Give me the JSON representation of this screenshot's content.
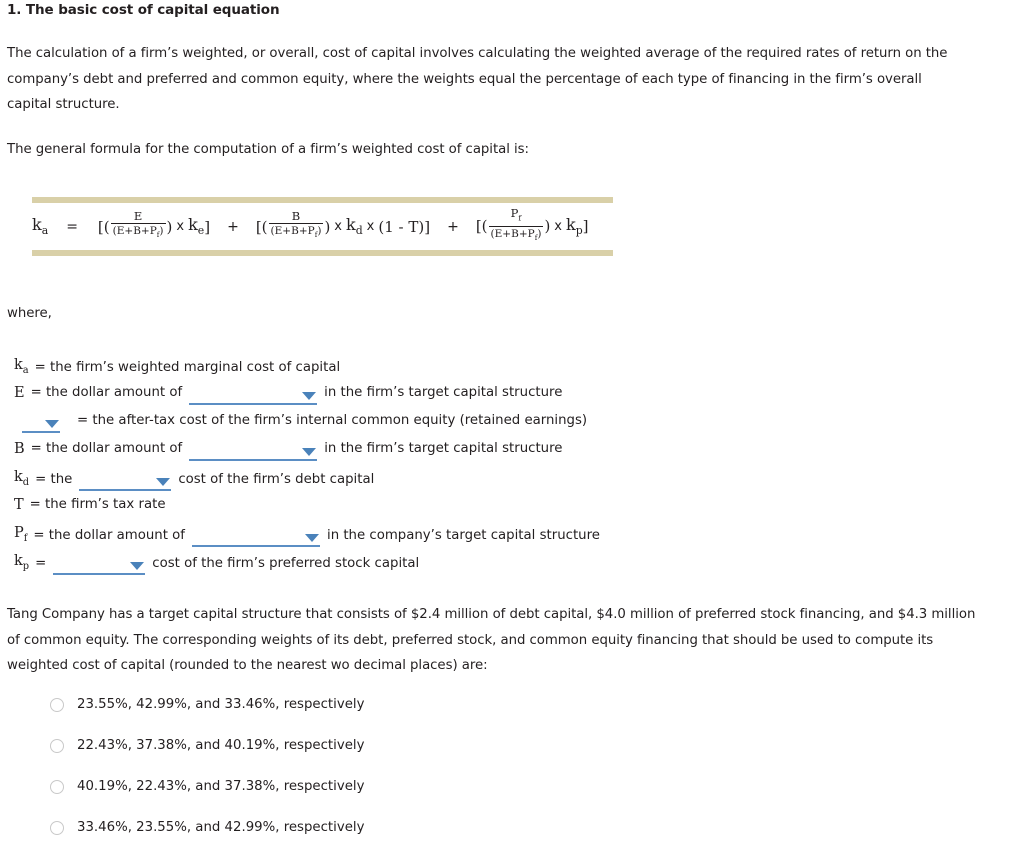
{
  "question": {
    "number_title": "1. The basic cost of capital equation",
    "intro_paragraph": "The calculation of a firm’s weighted, or overall, cost of capital involves calculating the weighted average of the required rates of return on the company’s debt and preferred and common equity, where the weights equal the percentage of each type of financing in the firm’s overall capital structure.",
    "formula_lead": "The general formula for the computation of a firm’s weighted cost of capital is:",
    "where_label": "where,",
    "problem_paragraph": "Tang Company has a target capital structure that consists of $2.4 million of debt capital, $4.0 million of preferred stock financing, and $4.3 million of common equity. The corresponding weights of its debt, preferred stock, and common equity financing that should be used to compute its weighted cost of capital (rounded to the nearest wo decimal places) are:"
  },
  "formula": {
    "band_color": "#d9d0a8",
    "lhs": "k",
    "lhs_sub": "a",
    "equals": "=",
    "plus": "+",
    "terms": [
      {
        "open": "[(",
        "numerator": "E",
        "denominator": "(E+B+P",
        "denominator_sub": "f",
        "denominator_close": ")",
        "close_paren": ")",
        "times": "x",
        "factor": "k",
        "factor_sub": "e",
        "close": "]"
      },
      {
        "open": "[(",
        "numerator": "B",
        "denominator": "(E+B+P",
        "denominator_sub": "f",
        "denominator_close": ")",
        "close_paren": ")",
        "times": "x",
        "factor": "k",
        "factor_sub": "d",
        "times2": "x",
        "tax_factor": "(1 - T)",
        "close": "]"
      },
      {
        "open": "[(",
        "numerator": "P",
        "numerator_sub": "f",
        "denominator": "(E+B+P",
        "denominator_sub": "f",
        "denominator_close": ")",
        "close_paren": ")",
        "times": "x",
        "factor": "k",
        "factor_sub": "p",
        "close": "]"
      }
    ]
  },
  "definitions": [
    {
      "symbol": "k",
      "symbol_sub": "a",
      "pre_text": "= the firm’s weighted marginal cost of capital",
      "has_dropdown": false,
      "post_text": ""
    },
    {
      "symbol": "E",
      "symbol_sub": "",
      "pre_text": "= the dollar amount of",
      "has_dropdown": true,
      "dropdown_value": "",
      "dropdown_width": "wide",
      "post_text": "in the firm’s target capital structure"
    },
    {
      "symbol": "",
      "symbol_sub": "",
      "pre_text": "",
      "has_dropdown": true,
      "dropdown_value": "",
      "dropdown_width": "short",
      "post_text": "= the after-tax cost of the firm’s internal common equity (retained earnings)"
    },
    {
      "symbol": "B",
      "symbol_sub": "",
      "pre_text": "= the dollar amount of",
      "has_dropdown": true,
      "dropdown_value": "",
      "dropdown_width": "wide",
      "post_text": "in the firm’s target capital structure"
    },
    {
      "symbol": "k",
      "symbol_sub": "d",
      "pre_text": "= the",
      "has_dropdown": true,
      "dropdown_value": "",
      "dropdown_width": "med",
      "post_text": "cost of the firm’s debt capital"
    },
    {
      "symbol": "T",
      "symbol_sub": "",
      "pre_text": "= the firm’s tax rate",
      "has_dropdown": false,
      "post_text": ""
    },
    {
      "symbol": "P",
      "symbol_sub": "f",
      "pre_text": "= the dollar amount of",
      "has_dropdown": true,
      "dropdown_value": "",
      "dropdown_width": "wide",
      "post_text": "in the company’s target capital structure"
    },
    {
      "symbol": "k",
      "symbol_sub": "p",
      "pre_text": "=",
      "has_dropdown": true,
      "dropdown_value": "",
      "dropdown_width": "med",
      "post_text": "cost of the firm’s preferred stock capital"
    }
  ],
  "options": [
    {
      "label": "23.55%, 42.99%, and 33.46%, respectively",
      "selected": false
    },
    {
      "label": "22.43%, 37.38%, and 40.19%, respectively",
      "selected": false
    },
    {
      "label": "40.19%, 22.43%, and 37.38%, respectively",
      "selected": false
    },
    {
      "label": "33.46%, 23.55%, and 42.99%, respectively",
      "selected": false
    }
  ],
  "colors": {
    "text": "#231f20",
    "band": "#d9d0a8",
    "dropdown_blue": "#5b8ec4",
    "caret_blue": "#4a82ba",
    "radio_border": "#c9c9c9"
  }
}
